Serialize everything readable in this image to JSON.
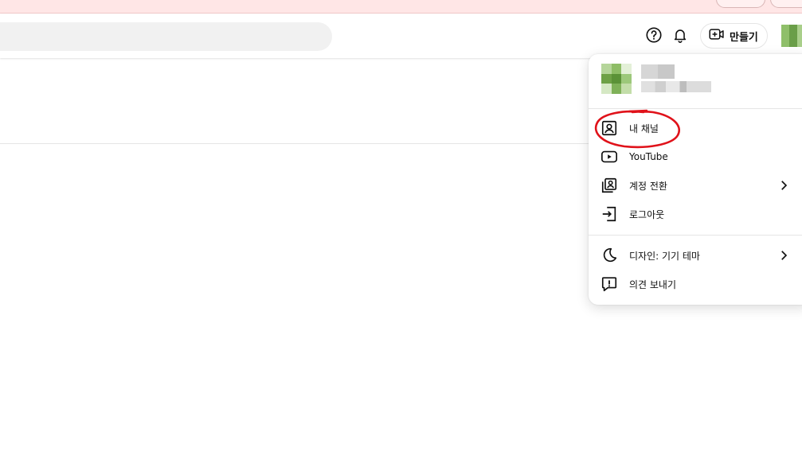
{
  "header": {
    "create_label": "만들기",
    "icons": [
      "help-icon",
      "bell-icon",
      "create-video-icon"
    ]
  },
  "account_menu": {
    "items": [
      {
        "label": "내 채널",
        "icon": "channel-icon",
        "has_submenu": false
      },
      {
        "label": "YouTube",
        "icon": "youtube-icon",
        "has_submenu": false
      },
      {
        "label": "계정 전환",
        "icon": "switch-account-icon",
        "has_submenu": true
      },
      {
        "label": "로그아웃",
        "icon": "sign-out-icon",
        "has_submenu": false
      },
      {
        "label": "디자인: 기기 테마",
        "icon": "moon-icon",
        "has_submenu": true
      },
      {
        "label": "의견 보내기",
        "icon": "feedback-icon",
        "has_submenu": false
      }
    ]
  },
  "colors": {
    "banner": "#ffe6e6",
    "annotation": "#e0121a",
    "search_bg": "#f1f1f1"
  }
}
